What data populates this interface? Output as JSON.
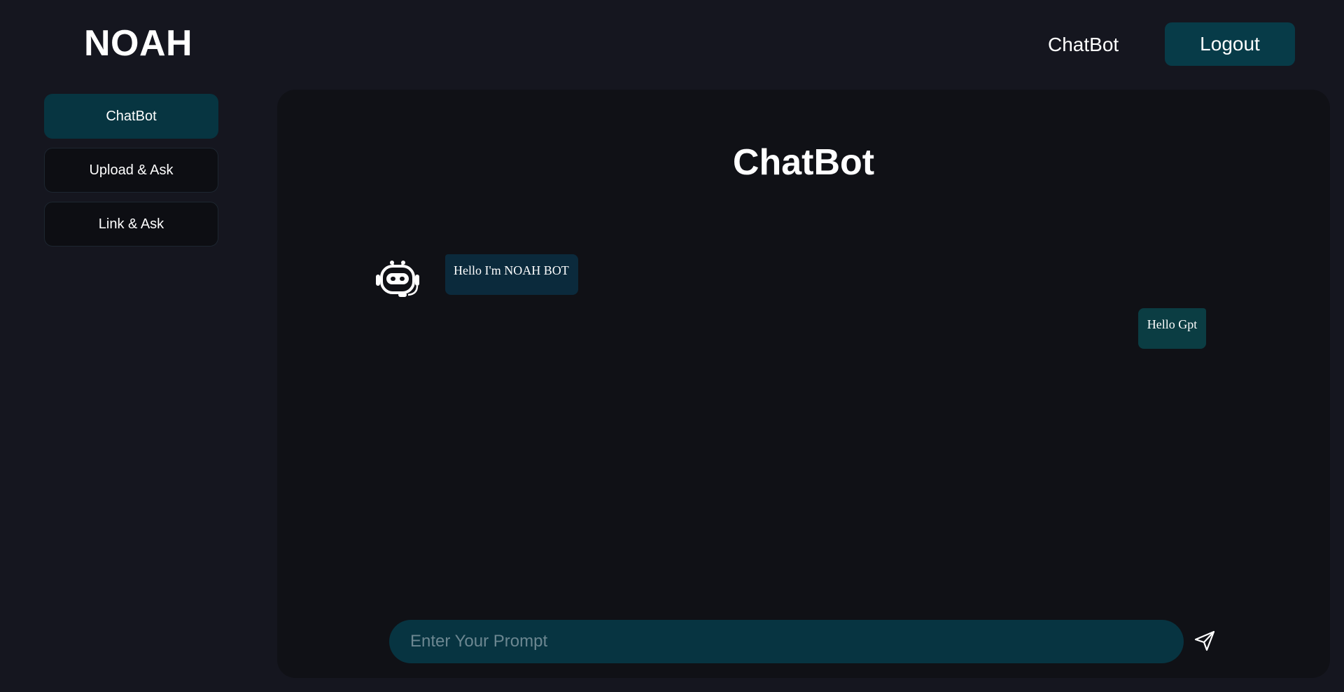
{
  "header": {
    "brand": "NOAH",
    "nav_link": "ChatBot",
    "logout_label": "Logout"
  },
  "sidebar": {
    "items": [
      {
        "label": "ChatBot",
        "active": true
      },
      {
        "label": "Upload & Ask",
        "active": false
      },
      {
        "label": "Link & Ask",
        "active": false
      }
    ]
  },
  "main": {
    "title": "ChatBot",
    "messages": [
      {
        "sender": "bot",
        "text": "Hello I'm NOAH BOT",
        "icon": "robot-icon"
      },
      {
        "sender": "user",
        "text": "Hello Gpt"
      }
    ],
    "prompt": {
      "value": "",
      "placeholder": "Enter Your Prompt"
    },
    "send_icon": "send-icon"
  },
  "colors": {
    "page_bg": "#15161f",
    "panel_bg": "#101116",
    "accent": "#073b48",
    "input_bg": "#073441",
    "bot_bubble": "#0b2a3c",
    "user_bubble": "#0b3d43"
  }
}
